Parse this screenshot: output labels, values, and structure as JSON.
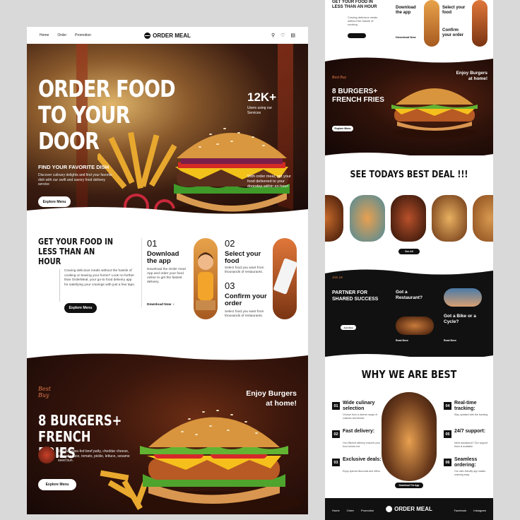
{
  "nav": {
    "links": [
      "Home",
      "Order",
      "Promotion"
    ],
    "brand": "ORDER MEAL"
  },
  "hero": {
    "title_line1": "ORDER FOOD",
    "title_line2": "TO YOUR DOOR",
    "stat": "12K+",
    "stat_label": "Users using our Services",
    "subtitle": "FIND YOUR FAVORITE DISH",
    "text": "Discover culinary delights and find your favorite dish with our swift and savory food delivery service",
    "right_text": "With order meal, get your food delivered to your doorstep within an hour!",
    "button": "Explore Menu"
  },
  "how": {
    "title": "GET YOUR FOOD IN LESS THAN AN HOUR",
    "text": "Craving delicious meals without the hassle of cooking or leaving your home? Look no further than OrderMeal, your go-to food delivery app for satisfying your cravings with just a few taps.",
    "button": "Explore Menu",
    "steps": [
      {
        "num": "01",
        "title": "Download the app",
        "desc": "Download the Order meal App and order your food online to get the fastest delivery.",
        "link": "Download Now"
      },
      {
        "num": "02",
        "title": "Select your food",
        "desc": "Select food you want from thousands of restaurants."
      },
      {
        "num": "03",
        "title": "Confirm your order",
        "desc": "Select food you want from thousands of restaurants."
      }
    ]
  },
  "promo": {
    "script_line1": "Best",
    "script_line2": "Buy",
    "title_line1": "8 BURGERS+",
    "title_line2": "FRENCH FRIES",
    "right_line1": "Enjoy Burgers",
    "right_line2": "at home!",
    "text": "100 % Grass-fed beef patty, cheddar cheese, special sauce, tomato, pickle, lettuce, sesame seed bun.",
    "button": "Explore Menu"
  },
  "right": {
    "top": {
      "title": "GET YOUR FOOD IN LESS THAN AN HOUR",
      "step1": "Download the app",
      "step2": "Select your food",
      "step3": "Confirm your order",
      "link": "Download Now"
    },
    "promo": {
      "right_line1": "Enjoy Burgers",
      "right_line2": "at home!",
      "title_line1": "8 BURGERS+",
      "title_line2": "FRENCH FRIES",
      "button": "Explore Menu"
    },
    "deals": {
      "title": "SEE TODAYS BEST DEAL !!!",
      "button": "See All"
    },
    "partner": {
      "title": "PARTNER FOR SHARED SUCCESS",
      "q1": "Got a Restaurant?",
      "q2": "Got a Bike or a Cycle?",
      "button": "Join Now",
      "read_more": "Read More"
    },
    "why": {
      "title": "WHY WE ARE BEST",
      "items": [
        {
          "num": "01",
          "title": "Wide culinary selection"
        },
        {
          "num": "02",
          "title": "Fast delivery:"
        },
        {
          "num": "03",
          "title": "Exclusive deals:"
        },
        {
          "num": "04",
          "title": "Real-time tracking:"
        },
        {
          "num": "05",
          "title": "24/7 support:"
        },
        {
          "num": "06",
          "title": "Seamless ordering:"
        }
      ],
      "button": "Download The App"
    },
    "footer": {
      "links": [
        "Home",
        "Order",
        "Promotion"
      ],
      "brand": "ORDER MEAL",
      "social": [
        "Facebook",
        "Instagram"
      ]
    }
  }
}
